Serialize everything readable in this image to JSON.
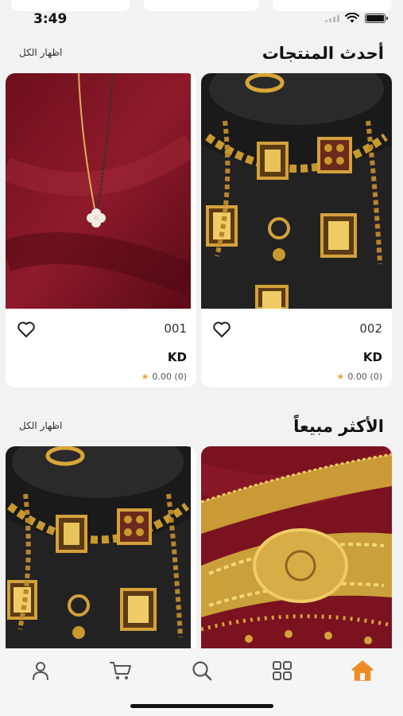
{
  "status_bar": {
    "time": "3:49",
    "icons": [
      "signal-icon",
      "wifi-icon",
      "battery-icon"
    ]
  },
  "latest_section": {
    "title": "أحدث المنتجات",
    "show_all_label": "اظهار الكل",
    "products": [
      {
        "code": "002",
        "currency": "KD",
        "rating": "0.00 (0)",
        "image": "gold-necklace-set-on-black-bust"
      },
      {
        "code": "001",
        "currency": "KD",
        "rating": "0.00 (0)",
        "image": "gold-chain-with-white-flower-pendant"
      }
    ]
  },
  "bestseller_section": {
    "title": "الأكثر مبيعاً",
    "show_all_label": "اظهار الكل",
    "products": [
      {
        "image": "gold-filigree-belt-on-red-velvet"
      },
      {
        "image": "gold-necklace-set-on-black-bust"
      }
    ]
  },
  "bottom_nav": {
    "items": [
      "home-icon",
      "grid-icon",
      "search-icon",
      "cart-icon",
      "profile-icon"
    ],
    "active": "home-icon"
  },
  "colors": {
    "accent": "#f08a24",
    "star": "#f2a33a",
    "background": "#f2f2f2",
    "card": "#ffffff"
  }
}
